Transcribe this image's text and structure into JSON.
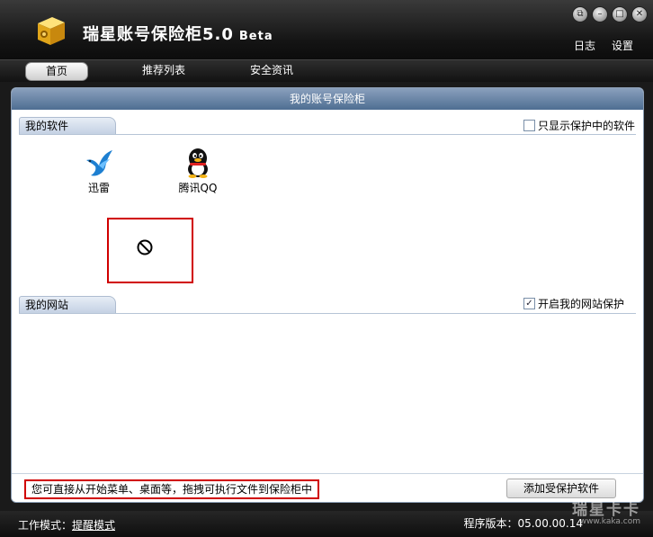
{
  "app": {
    "title": "瑞星账号保险柜5.0",
    "beta": "Beta",
    "links": [
      "日志",
      "设置"
    ],
    "window_buttons": [
      "restore-icon",
      "minimize-icon",
      "maximize-icon",
      "close-icon"
    ]
  },
  "nav": {
    "tabs": [
      {
        "label": "首页",
        "active": true
      },
      {
        "label": "推荐列表",
        "active": false
      },
      {
        "label": "安全资讯",
        "active": false
      }
    ]
  },
  "panel": {
    "title": "我的账号保险柜"
  },
  "software": {
    "section_label": "我的软件",
    "filter_label": "只显示保护中的软件",
    "filter_checked": false,
    "items": [
      {
        "label": "迅雷",
        "icon": "xunlei-bird-icon"
      },
      {
        "label": "腾讯QQ",
        "icon": "qq-penguin-icon"
      }
    ],
    "drop_icon": "no-drop-icon"
  },
  "websites": {
    "section_label": "我的网站",
    "toggle_label": "开启我的网站保护",
    "toggle_checked": true
  },
  "footer": {
    "hint": "您可直接从开始菜单、桌面等，拖拽可执行文件到保险柜中",
    "add_button": "添加受保护软件"
  },
  "status": {
    "mode_label": "工作模式：",
    "mode_value": "提醒模式",
    "version_label": "程序版本：",
    "version_value": "05.00.00.14"
  },
  "watermark": {
    "text": "瑞星卡卡",
    "url": "www.kaka.com"
  },
  "colors": {
    "panel_header": "#5f7ea3",
    "highlight": "#d00000",
    "dark": "#141414"
  }
}
